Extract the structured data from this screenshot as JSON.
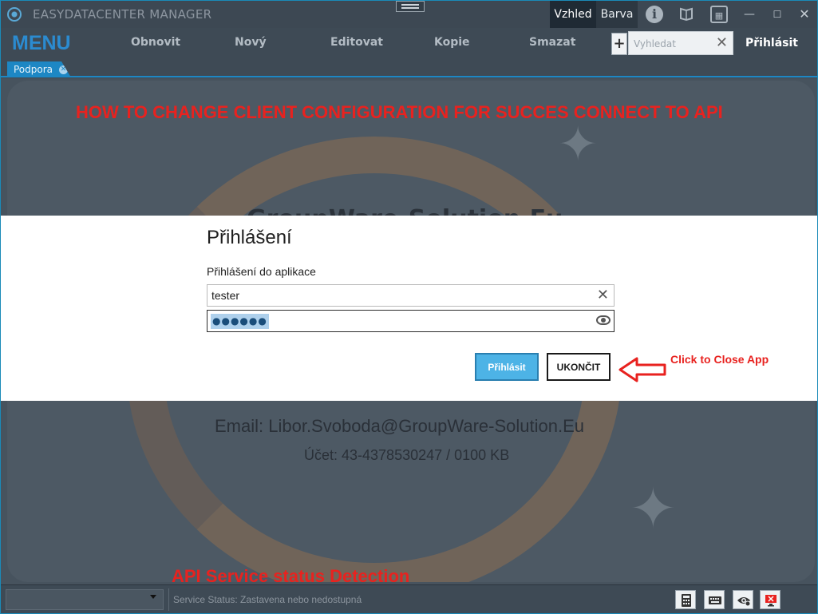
{
  "titlebar": {
    "title": "EASYDATACENTER MANAGER",
    "appearance_label": "Vzhled",
    "color_label": "Barva"
  },
  "menu": {
    "label": "MENU",
    "items": [
      {
        "label": "Obnovit"
      },
      {
        "label": "Nový"
      },
      {
        "label": "Editovat"
      },
      {
        "label": "Kopie"
      },
      {
        "label": "Smazat"
      }
    ],
    "plus_label": "+",
    "search_placeholder": "Vyhledat",
    "login_label": "Přihlásit"
  },
  "tabs": [
    {
      "label": "Podpora"
    }
  ],
  "background": {
    "heading": "HOW TO CHANGE CLIENT CONFIGURATION FOR SUCCES CONNECT TO API",
    "company": "GroupWare-Solution.Eu",
    "email": "Email: Libor.Svoboda@GroupWare-Solution.Eu",
    "account": "Účet: 43-4378530247 / 0100 KB",
    "api_heading": "API Service status Detection"
  },
  "login_dialog": {
    "title": "Přihlášení",
    "subtitle": "Přihlášení do aplikace",
    "username_value": "tester",
    "password_mask": "●●●●●●",
    "login_button": "Přihlásit",
    "exit_button": "UKONČIT",
    "annotation": "Click to Close App"
  },
  "statusbar": {
    "text": "Service Status: Zastavena nebo nedostupná"
  },
  "colors": {
    "accent": "#1d87c4",
    "menu_blue": "#2b8bd0",
    "annotation_red": "#e8221f",
    "login_button": "#4db3e6"
  },
  "icons": {
    "info": "info-icon",
    "book": "book-icon",
    "board": "board-icon",
    "calculator": "calculator-icon",
    "keyboard": "keyboard-icon",
    "eye": "eye-icon",
    "monitor": "monitor-icon"
  }
}
